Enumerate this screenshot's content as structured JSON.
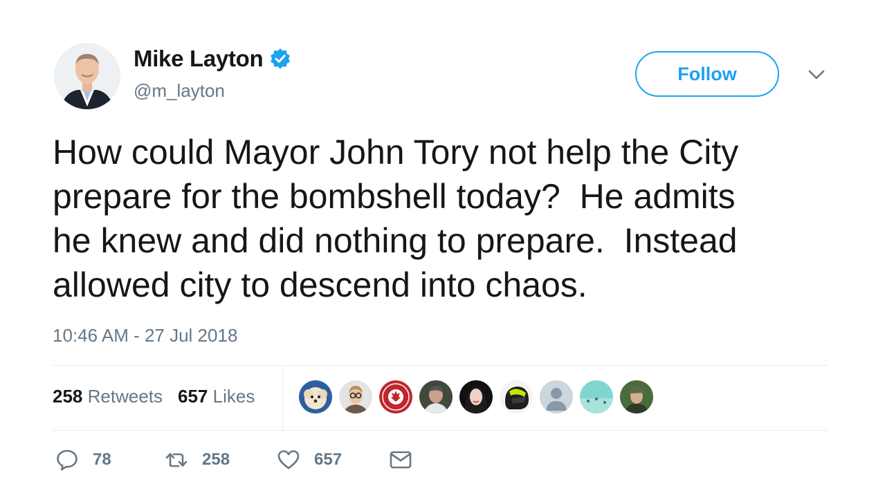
{
  "author": {
    "name": "Mike Layton",
    "handle": "@m_layton",
    "verified": true
  },
  "follow_label": "Follow",
  "tweet": {
    "text": "How could Mayor John Tory not help the City\nprepare for the bombshell today?  He admits\nhe knew and did nothing to prepare.  Instead\nallowed city to descend into chaos.",
    "timestamp": "10:46 AM - 27 Jul 2018"
  },
  "stats": {
    "retweets_count": "258",
    "retweets_label": "Retweets",
    "likes_count": "657",
    "likes_label": "Likes"
  },
  "liker_avatars": [
    "dog-avatar",
    "glasses-man-avatar",
    "proudly-canadian-badge-avatar",
    "man-avatar",
    "woman-avatar",
    "helmet-avatar",
    "default-avatar",
    "beach-avatar",
    "cap-man-avatar"
  ],
  "actions": {
    "replies": "78",
    "retweets": "258",
    "likes": "657"
  },
  "colors": {
    "accent": "#1da1f2",
    "text": "#14171a",
    "secondary": "#657786",
    "divider": "#e6ecf0"
  }
}
